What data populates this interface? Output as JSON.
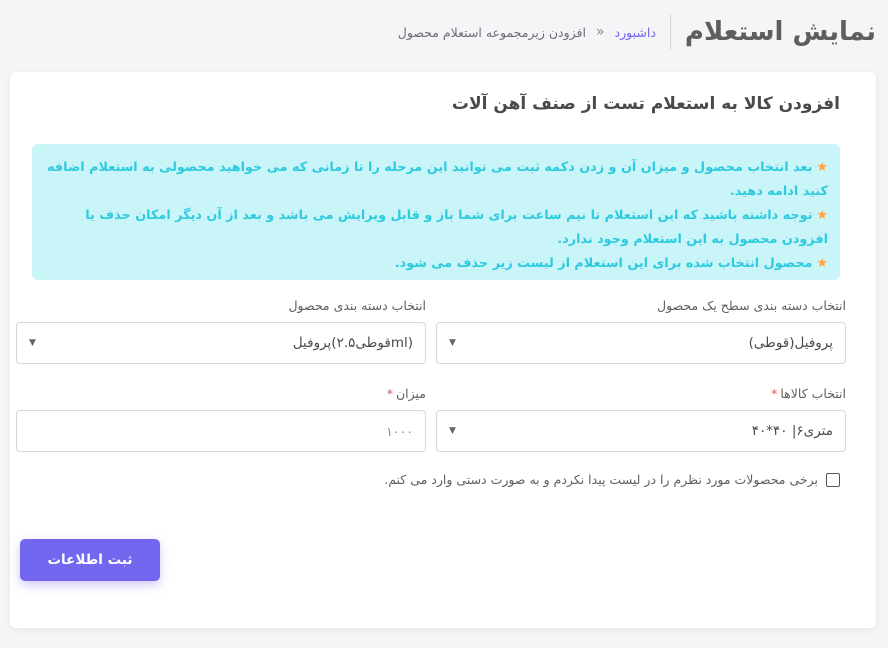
{
  "header": {
    "title": "نمایش استعلام",
    "breadcrumb": {
      "home": "داشبورد",
      "separator": "«",
      "current": "افزودن زیرمجموعه استعلام محصول"
    }
  },
  "card": {
    "title": "افزودن کالا به استعلام تست از صنف آهن آلات",
    "alert": {
      "lines": [
        "بعد انتخاب محصول و میزان آن و زدن دکمه ثبت می توانید این مرحله را تا زمانی که می خواهید محصولی به استعلام اضافه کنید ادامه دهید.",
        "توجه داشته باشید که این استعلام تا نیم ساعت برای شما باز و قابل ویرایش می باشد و بعد از آن دیگر امکان حذف یا افزودن محصول به این استعلام وجود ندارد.",
        "محصول انتخاب شده برای این استعلام از لیست زیر حذف می شود."
      ],
      "bullet": "★",
      "text_color": "#2ecae0",
      "bullet_color": "#ff9f43",
      "bg_color": "#c9f5f8"
    }
  },
  "form": {
    "top_category": {
      "label": "انتخاب دسته بندی سطح یک محصول",
      "value": "پروفیل(قوطی)"
    },
    "category": {
      "label": "انتخاب دسته بندی محصول",
      "value": "(mlقوطی۲.۵)پروفیل"
    },
    "product": {
      "label": "انتخاب کالاها",
      "required": "*",
      "value": "متری۶| ۴۰*۴۰"
    },
    "quantity": {
      "label": "میزان",
      "required": "*",
      "value": "۱۰۰۰"
    },
    "manual_checkbox": {
      "label": "برخی محصولات مورد نظرم را در لیست پیدا نکردم و به صورت دستی وارد می کنم.",
      "checked": false
    },
    "submit_label": "ثبت اطلاعات",
    "accent_color": "#7367f0"
  }
}
